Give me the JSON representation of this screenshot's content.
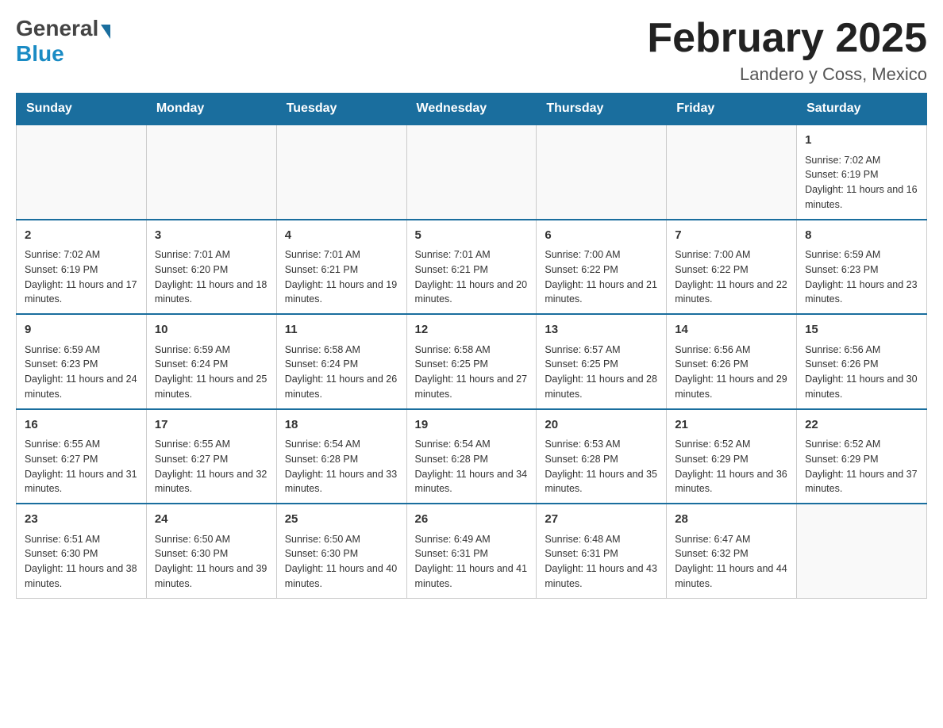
{
  "header": {
    "title": "February 2025",
    "location": "Landero y Coss, Mexico",
    "logo_general": "General",
    "logo_blue": "Blue"
  },
  "weekdays": [
    "Sunday",
    "Monday",
    "Tuesday",
    "Wednesday",
    "Thursday",
    "Friday",
    "Saturday"
  ],
  "weeks": [
    [
      {
        "day": "",
        "info": ""
      },
      {
        "day": "",
        "info": ""
      },
      {
        "day": "",
        "info": ""
      },
      {
        "day": "",
        "info": ""
      },
      {
        "day": "",
        "info": ""
      },
      {
        "day": "",
        "info": ""
      },
      {
        "day": "1",
        "info": "Sunrise: 7:02 AM\nSunset: 6:19 PM\nDaylight: 11 hours and 16 minutes."
      }
    ],
    [
      {
        "day": "2",
        "info": "Sunrise: 7:02 AM\nSunset: 6:19 PM\nDaylight: 11 hours and 17 minutes."
      },
      {
        "day": "3",
        "info": "Sunrise: 7:01 AM\nSunset: 6:20 PM\nDaylight: 11 hours and 18 minutes."
      },
      {
        "day": "4",
        "info": "Sunrise: 7:01 AM\nSunset: 6:21 PM\nDaylight: 11 hours and 19 minutes."
      },
      {
        "day": "5",
        "info": "Sunrise: 7:01 AM\nSunset: 6:21 PM\nDaylight: 11 hours and 20 minutes."
      },
      {
        "day": "6",
        "info": "Sunrise: 7:00 AM\nSunset: 6:22 PM\nDaylight: 11 hours and 21 minutes."
      },
      {
        "day": "7",
        "info": "Sunrise: 7:00 AM\nSunset: 6:22 PM\nDaylight: 11 hours and 22 minutes."
      },
      {
        "day": "8",
        "info": "Sunrise: 6:59 AM\nSunset: 6:23 PM\nDaylight: 11 hours and 23 minutes."
      }
    ],
    [
      {
        "day": "9",
        "info": "Sunrise: 6:59 AM\nSunset: 6:23 PM\nDaylight: 11 hours and 24 minutes."
      },
      {
        "day": "10",
        "info": "Sunrise: 6:59 AM\nSunset: 6:24 PM\nDaylight: 11 hours and 25 minutes."
      },
      {
        "day": "11",
        "info": "Sunrise: 6:58 AM\nSunset: 6:24 PM\nDaylight: 11 hours and 26 minutes."
      },
      {
        "day": "12",
        "info": "Sunrise: 6:58 AM\nSunset: 6:25 PM\nDaylight: 11 hours and 27 minutes."
      },
      {
        "day": "13",
        "info": "Sunrise: 6:57 AM\nSunset: 6:25 PM\nDaylight: 11 hours and 28 minutes."
      },
      {
        "day": "14",
        "info": "Sunrise: 6:56 AM\nSunset: 6:26 PM\nDaylight: 11 hours and 29 minutes."
      },
      {
        "day": "15",
        "info": "Sunrise: 6:56 AM\nSunset: 6:26 PM\nDaylight: 11 hours and 30 minutes."
      }
    ],
    [
      {
        "day": "16",
        "info": "Sunrise: 6:55 AM\nSunset: 6:27 PM\nDaylight: 11 hours and 31 minutes."
      },
      {
        "day": "17",
        "info": "Sunrise: 6:55 AM\nSunset: 6:27 PM\nDaylight: 11 hours and 32 minutes."
      },
      {
        "day": "18",
        "info": "Sunrise: 6:54 AM\nSunset: 6:28 PM\nDaylight: 11 hours and 33 minutes."
      },
      {
        "day": "19",
        "info": "Sunrise: 6:54 AM\nSunset: 6:28 PM\nDaylight: 11 hours and 34 minutes."
      },
      {
        "day": "20",
        "info": "Sunrise: 6:53 AM\nSunset: 6:28 PM\nDaylight: 11 hours and 35 minutes."
      },
      {
        "day": "21",
        "info": "Sunrise: 6:52 AM\nSunset: 6:29 PM\nDaylight: 11 hours and 36 minutes."
      },
      {
        "day": "22",
        "info": "Sunrise: 6:52 AM\nSunset: 6:29 PM\nDaylight: 11 hours and 37 minutes."
      }
    ],
    [
      {
        "day": "23",
        "info": "Sunrise: 6:51 AM\nSunset: 6:30 PM\nDaylight: 11 hours and 38 minutes."
      },
      {
        "day": "24",
        "info": "Sunrise: 6:50 AM\nSunset: 6:30 PM\nDaylight: 11 hours and 39 minutes."
      },
      {
        "day": "25",
        "info": "Sunrise: 6:50 AM\nSunset: 6:30 PM\nDaylight: 11 hours and 40 minutes."
      },
      {
        "day": "26",
        "info": "Sunrise: 6:49 AM\nSunset: 6:31 PM\nDaylight: 11 hours and 41 minutes."
      },
      {
        "day": "27",
        "info": "Sunrise: 6:48 AM\nSunset: 6:31 PM\nDaylight: 11 hours and 43 minutes."
      },
      {
        "day": "28",
        "info": "Sunrise: 6:47 AM\nSunset: 6:32 PM\nDaylight: 11 hours and 44 minutes."
      },
      {
        "day": "",
        "info": ""
      }
    ]
  ]
}
